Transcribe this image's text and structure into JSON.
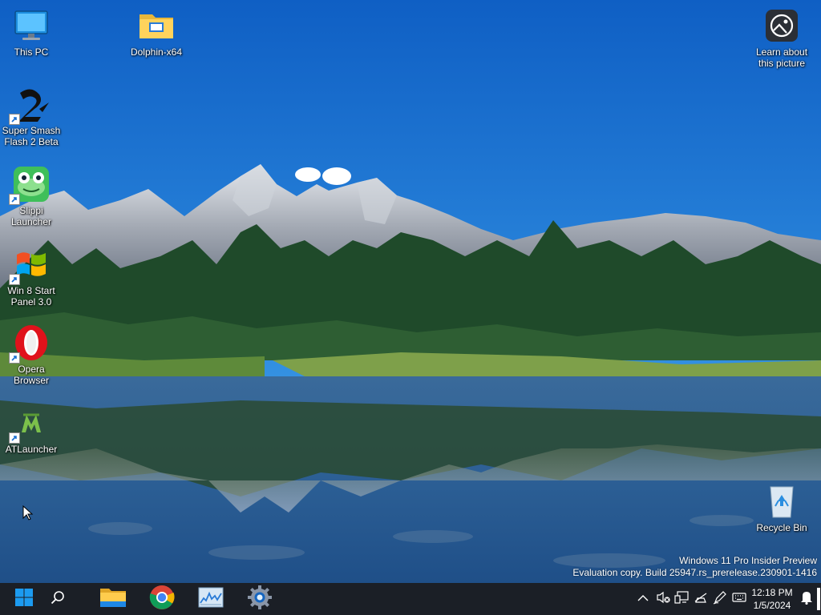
{
  "desktop": {
    "icons": [
      {
        "label": "This PC",
        "icon": "computer-icon"
      },
      {
        "label": "Dolphin-x64",
        "icon": "folder-icon"
      },
      {
        "label": "Super Smash Flash 2 Beta",
        "icon": "ssf2-icon",
        "shortcut": true
      },
      {
        "label": "Slippi Launcher",
        "icon": "frog-icon",
        "shortcut": true
      },
      {
        "label": "Win 8 Start Panel 3.0",
        "icon": "windows-logo-icon",
        "shortcut": true
      },
      {
        "label": "Opera Browser",
        "icon": "opera-icon",
        "shortcut": true
      },
      {
        "label": "ATLauncher",
        "icon": "atlauncher-icon",
        "shortcut": true
      },
      {
        "label": "Learn about this picture",
        "icon": "camera-spotlight-icon"
      },
      {
        "label": "Recycle Bin",
        "icon": "recycle-bin-icon"
      }
    ]
  },
  "watermark": {
    "line1": "Windows 11 Pro Insider Preview",
    "line2": "Evaluation copy. Build 25947.rs_prerelease.230901-1416"
  },
  "taskbar": {
    "pinned": [
      {
        "name": "start-button",
        "icon": "windows-start-icon"
      },
      {
        "name": "search-button",
        "icon": "search-icon"
      },
      {
        "name": "file-explorer-button",
        "icon": "folder-icon"
      },
      {
        "name": "chrome-button",
        "icon": "chrome-icon"
      },
      {
        "name": "resource-monitor-button",
        "icon": "monitor-chart-icon"
      },
      {
        "name": "settings-button",
        "icon": "gear-icon"
      }
    ],
    "tray": {
      "icons": [
        "chevron-up-icon",
        "speaker-muted-icon",
        "network-icon",
        "battery-icon",
        "pen-icon",
        "keyboard-icon"
      ],
      "time": "12:18 PM",
      "date": "1/5/2024",
      "notification_icon": "bell-icon"
    }
  },
  "colors": {
    "taskbar": "#1b1f26",
    "sky_top": "#1565c8",
    "sky_bottom": "#4aa3e8",
    "accent_blue": "#0078d4"
  }
}
